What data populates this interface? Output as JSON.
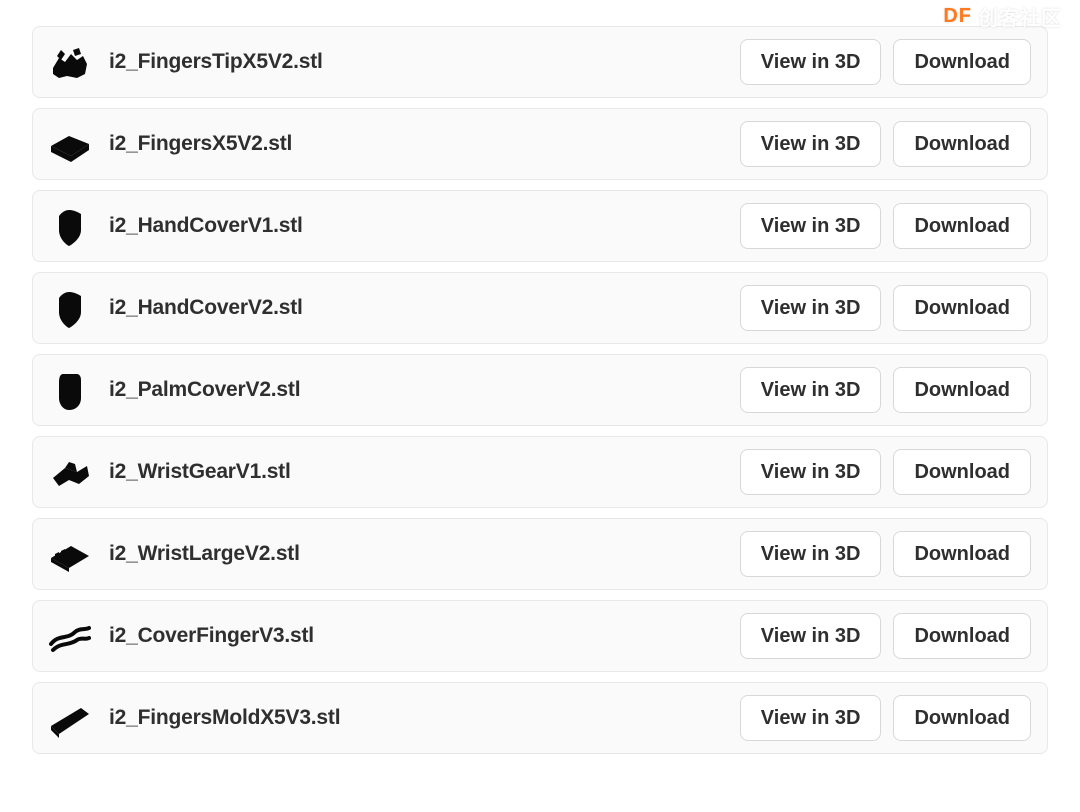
{
  "watermark": {
    "df": "DF",
    "text": "创客社区"
  },
  "buttons": {
    "view": "View in 3D",
    "download": "Download"
  },
  "files": [
    {
      "name": "i2_FingersTipX5V2.stl",
      "icon": "cluster"
    },
    {
      "name": "i2_FingersX5V2.stl",
      "icon": "slab"
    },
    {
      "name": "i2_HandCoverV1.stl",
      "icon": "shield"
    },
    {
      "name": "i2_HandCoverV2.stl",
      "icon": "shield"
    },
    {
      "name": "i2_PalmCoverV2.stl",
      "icon": "mitt"
    },
    {
      "name": "i2_WristGearV1.stl",
      "icon": "gearblock"
    },
    {
      "name": "i2_WristLargeV2.stl",
      "icon": "wedge"
    },
    {
      "name": "i2_CoverFingerV3.stl",
      "icon": "strands"
    },
    {
      "name": "i2_FingersMoldX5V3.stl",
      "icon": "bar"
    }
  ]
}
